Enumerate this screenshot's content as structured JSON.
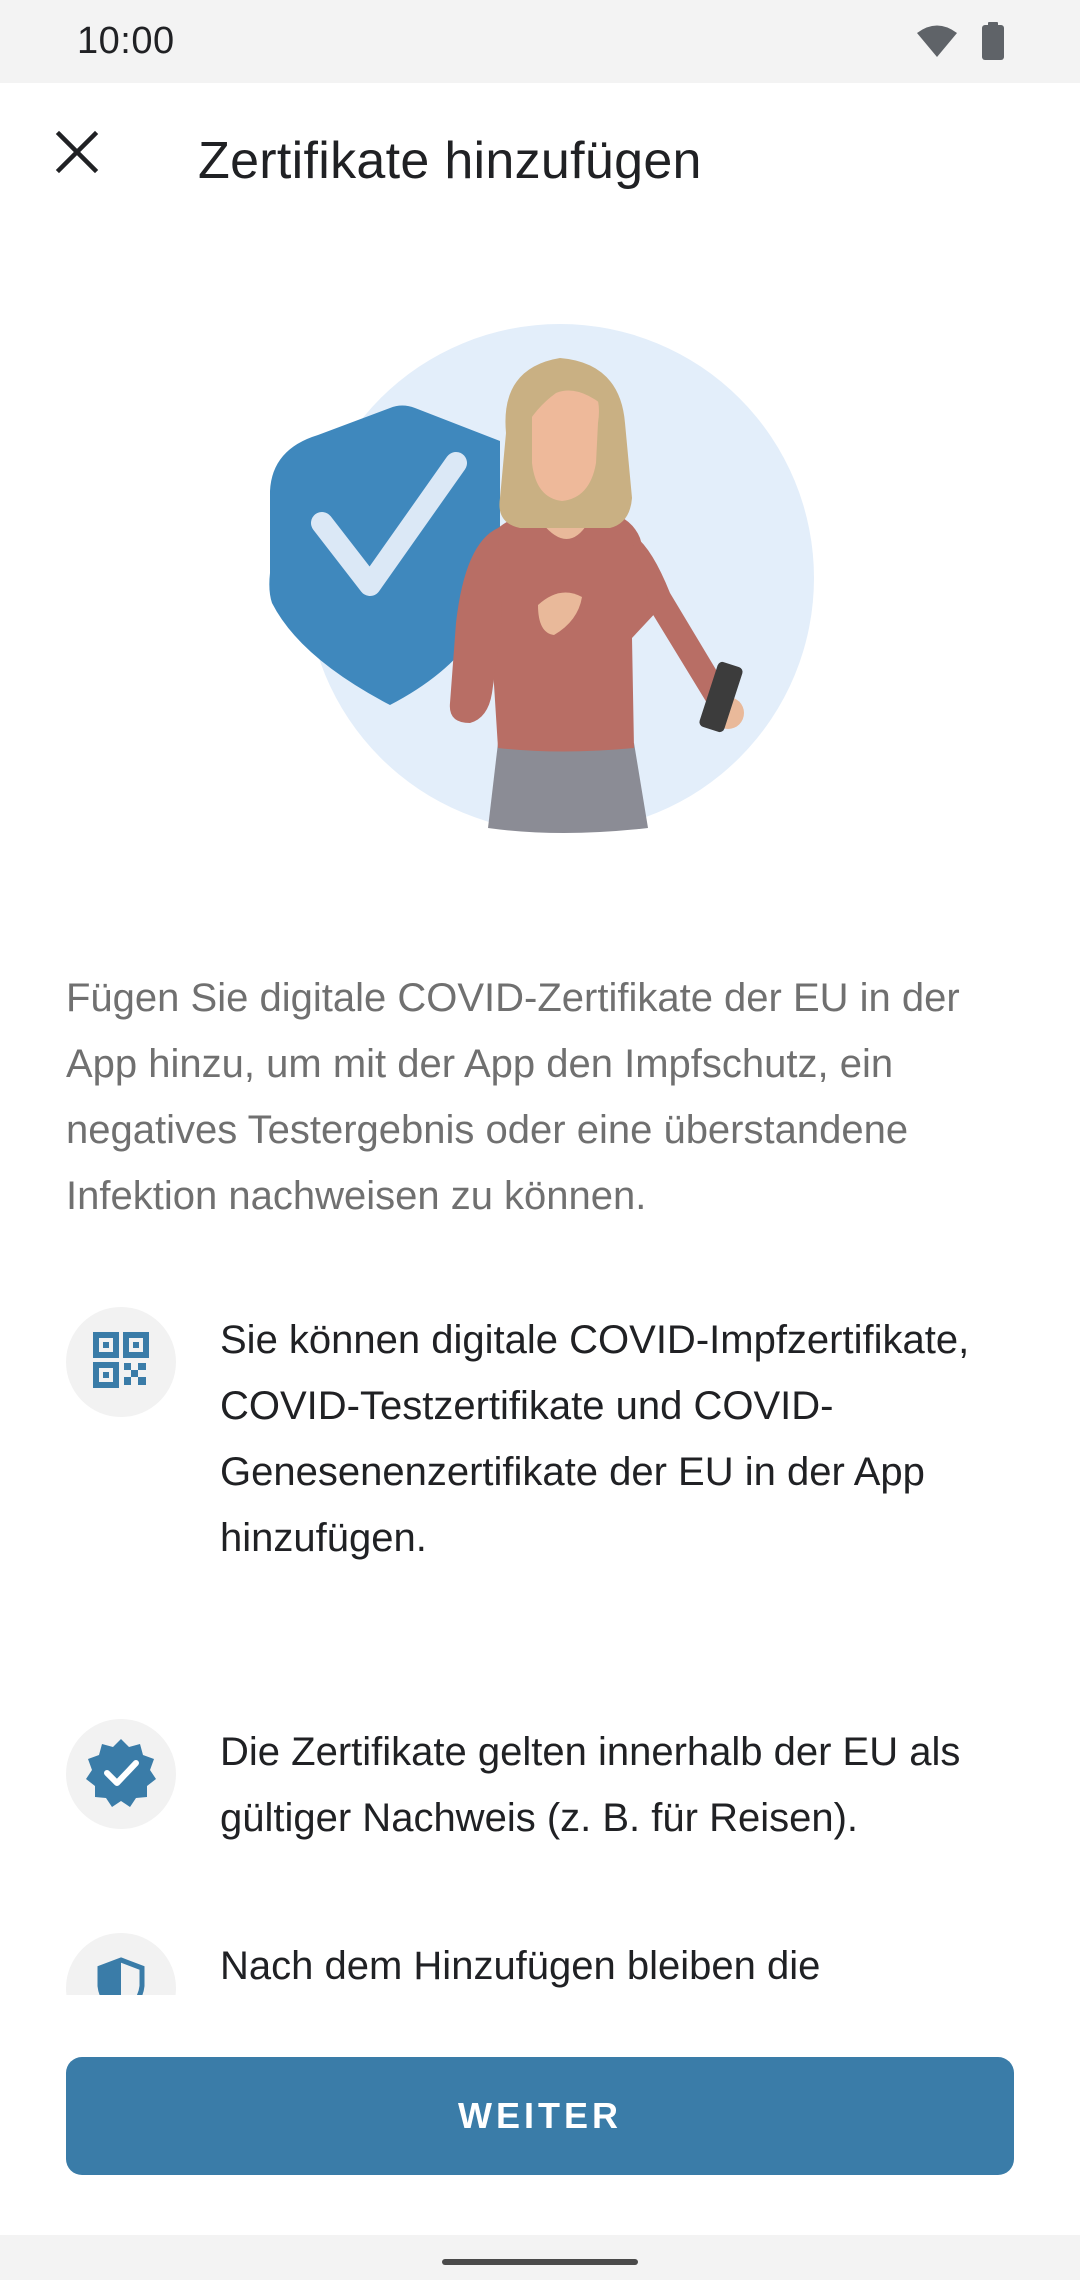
{
  "status_bar": {
    "time": "10:00",
    "icons": [
      "wifi-icon",
      "battery-icon"
    ]
  },
  "app_bar": {
    "close_icon": "close-icon",
    "title": "Zertifikate hinzufügen"
  },
  "intro_text": "Fügen Sie digitale COVID-Zertifikate der EU in der App hinzu, um mit der App den Impfschutz, ein negatives Testergebnis oder eine überstandene Infektion nachweisen zu können.",
  "features": [
    {
      "icon": "qr-code-icon",
      "text": "Sie können digitale COVID-Impfzertifikate, COVID-Testzertifikate und COVID-Genesenenzertifikate der EU in der App hinzufügen."
    },
    {
      "icon": "verified-badge-icon",
      "text": "Die Zertifikate gelten innerhalb der EU als gültiger Nachweis (z. B. für Reisen)."
    },
    {
      "icon": "shield-icon",
      "text": "Nach dem Hinzufügen bleiben die"
    }
  ],
  "continue_button": {
    "label": "WEITER"
  },
  "colors": {
    "primary": "#3a7ca8",
    "illustration_bg": "#e3eefa",
    "shield": "#3f88bd",
    "text_primary": "#202124",
    "text_secondary": "#707070"
  }
}
